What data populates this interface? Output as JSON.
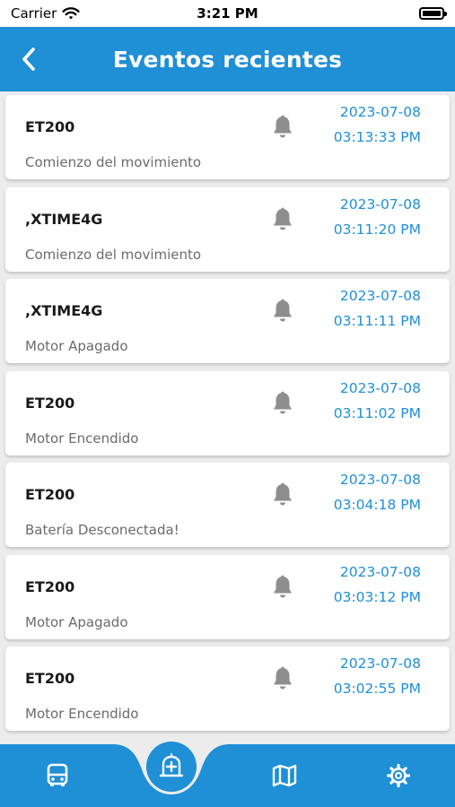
{
  "status_bar": {
    "carrier": "Carrier",
    "time": "3:21 PM",
    "battery_level": 1.0
  },
  "header": {
    "title": "Eventos recientes"
  },
  "colors": {
    "primary": "#1f8fd6",
    "background": "#ececec",
    "card": "#ffffff",
    "bell": "#8e8e8e"
  },
  "events": [
    {
      "device": "ET200",
      "description": "Comienzo del movimiento",
      "date": "2023-07-08",
      "time": "03:13:33 PM"
    },
    {
      "device": ",XTIME4G",
      "description": "Comienzo del movimiento",
      "date": "2023-07-08",
      "time": "03:11:20 PM"
    },
    {
      "device": ",XTIME4G",
      "description": "Motor Apagado",
      "date": "2023-07-08",
      "time": "03:11:11 PM"
    },
    {
      "device": "ET200",
      "description": "Motor Encendido",
      "date": "2023-07-08",
      "time": "03:11:02 PM"
    },
    {
      "device": "ET200",
      "description": "Batería Desconectada!",
      "date": "2023-07-08",
      "time": "03:04:18 PM"
    },
    {
      "device": "ET200",
      "description": "Motor Apagado",
      "date": "2023-07-08",
      "time": "03:03:12 PM"
    },
    {
      "device": "ET200",
      "description": "Motor Encendido",
      "date": "2023-07-08",
      "time": "03:02:55 PM"
    }
  ],
  "icons": {
    "back": "chevron-left-icon",
    "event": "bell-icon",
    "nav": [
      "bus-icon",
      "alert-building-icon",
      "map-icon",
      "gear-icon"
    ]
  }
}
